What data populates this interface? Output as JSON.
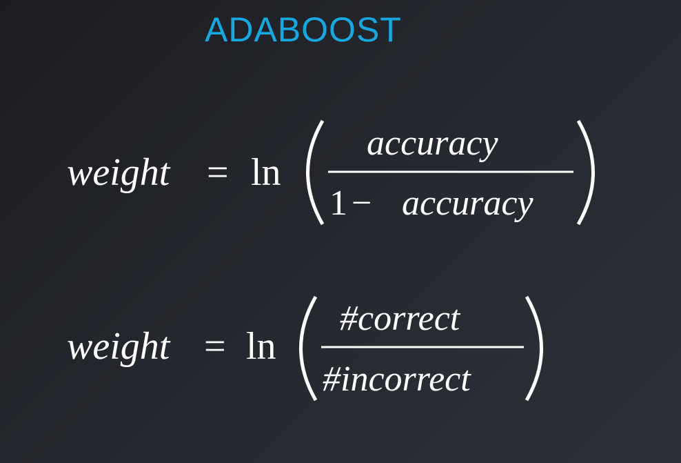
{
  "title": "ADABOOST",
  "formula1": {
    "lhs": "weight",
    "eq": "=",
    "fn": "ln",
    "numerator": "accuracy",
    "denominator_prefix": "1",
    "denominator_minus": "−",
    "denominator_var": "accuracy"
  },
  "formula2": {
    "lhs": "weight",
    "eq": "=",
    "fn": "ln",
    "numerator": "#correct",
    "denominator": "#incorrect"
  }
}
